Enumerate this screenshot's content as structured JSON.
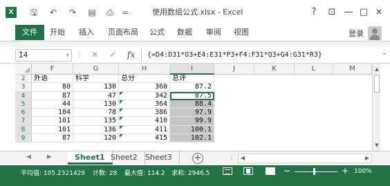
{
  "window": {
    "title": "使用数组公式.xlsx - Excel",
    "app_icon": "X",
    "help": "?",
    "ribbon_display": "⊡",
    "minimize": "—",
    "maximize": "□",
    "close": "×"
  },
  "quick_access": {
    "save": "🖫",
    "undo": "↶",
    "redo": "↷",
    "open": "▤",
    "print": "⎙",
    "customize": "="
  },
  "ribbon": {
    "tabs": [
      "文件",
      "开始",
      "插入",
      "页面布局",
      "公式",
      "数据",
      "审阅",
      "视图"
    ],
    "login": "登录"
  },
  "formula_bar": {
    "name_box": "I4",
    "name_box_dropdown": "▾",
    "separator": "⋮",
    "cancel_icon": "✕",
    "enter_icon": "✓",
    "fx_label": "fx",
    "formula": "{=D4:D31*O3+E4:E31*P3+F4:F31*Q3+G4:G31*R3}",
    "expand_icon": "⌄"
  },
  "grid": {
    "columns": [
      "F",
      "G",
      "H",
      "I",
      "J",
      "K",
      "L",
      "M"
    ],
    "active_column": "I",
    "rows": [
      {
        "num": "2",
        "F": "外语",
        "G": "科学",
        "H": "总分",
        "I": "总评"
      },
      {
        "num": "3",
        "F": "80",
        "G": "130",
        "H": "360",
        "I": "87.2"
      },
      {
        "num": "4",
        "F": "87",
        "G": "47",
        "H": "342",
        "I": "87.5"
      },
      {
        "num": "5",
        "F": "44",
        "G": "130",
        "H": "364",
        "I": "88.4"
      },
      {
        "num": "6",
        "F": "104",
        "G": "78",
        "H": "386",
        "I": "97.9"
      },
      {
        "num": "7",
        "F": "101",
        "G": "135",
        "H": "410",
        "I": "99.9"
      },
      {
        "num": "8",
        "F": "101",
        "G": "136",
        "H": "411",
        "I": "100.1"
      },
      {
        "num": "9",
        "F": "87",
        "G": "120",
        "H": "415",
        "I": "102.1"
      }
    ],
    "selected_rows": [
      "4",
      "5",
      "6",
      "7",
      "8",
      "9"
    ]
  },
  "sheets": {
    "tabs": [
      "Sheet1",
      "Sheet2",
      "Sheet3"
    ],
    "active": "Sheet1",
    "add": "+",
    "nav_prev": "◀",
    "nav_next": "▶",
    "more": "⋮"
  },
  "status": {
    "average": "平均值: 105.2321429",
    "count": "计数: 28",
    "max": "最大值: 114.2",
    "sum": "求和: 2946.5",
    "zoom_minus": "−",
    "zoom_plus": "+",
    "zoom_level": "100%"
  }
}
